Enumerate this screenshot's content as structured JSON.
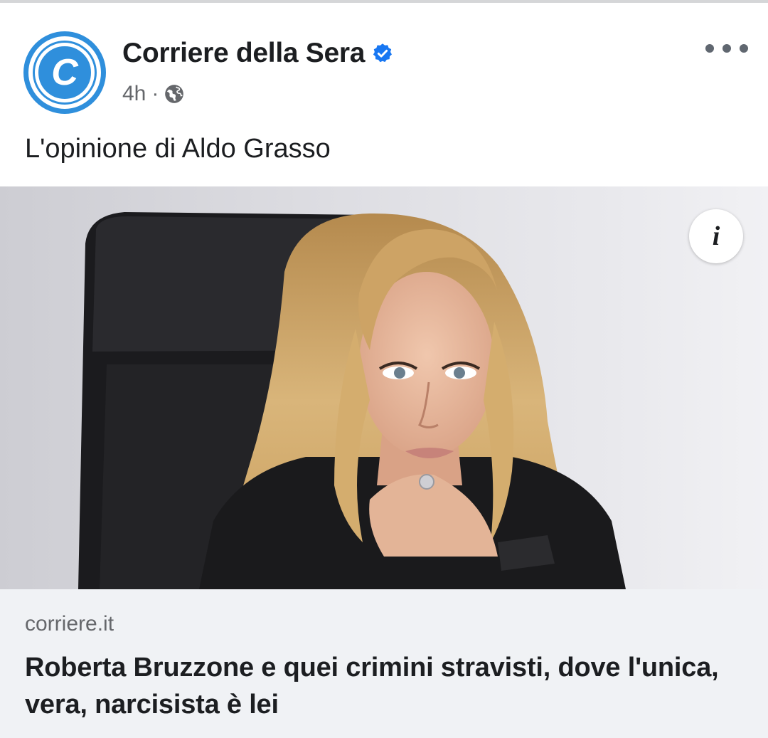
{
  "post": {
    "page_name": "Corriere della Sera",
    "avatar_letter": "C",
    "verified_icon": "verified-badge-icon",
    "time": "4h",
    "separator": "·",
    "audience_icon": "globe-icon",
    "text": "L'opinione di Aldo Grasso"
  },
  "media": {
    "info_label": "i"
  },
  "link": {
    "domain": "corriere.it",
    "title": "Roberta Bruzzone e quei crimini stravisti, dove l'unica, vera, narcisista è lei"
  },
  "colors": {
    "brand_blue": "#2f8fdc",
    "verified_blue": "#1877f2",
    "meta_gray": "#65676b",
    "link_bg": "#f0f2f5"
  }
}
